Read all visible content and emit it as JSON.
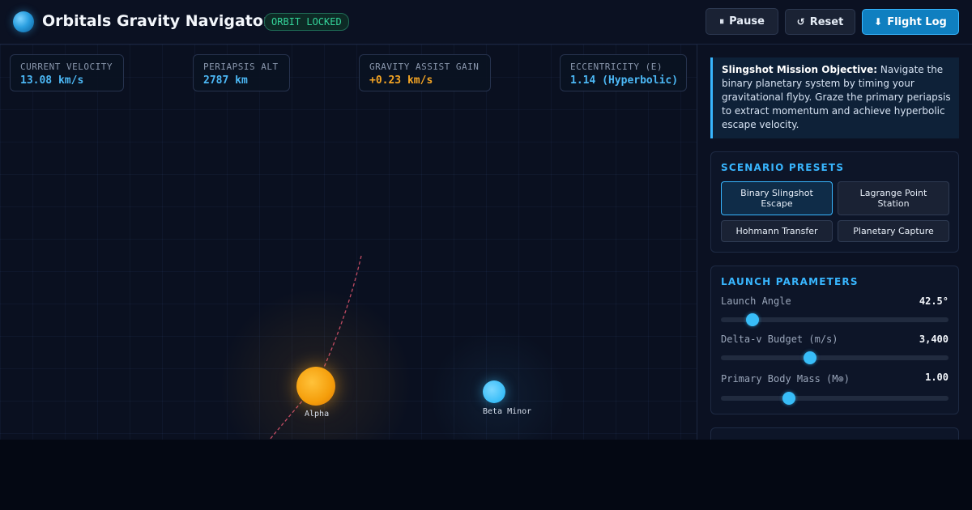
{
  "header": {
    "title": "Orbitals Gravity Navigator",
    "status_badge": "ORBIT LOCKED",
    "buttons": {
      "pause": {
        "icon": "⏸",
        "label": "Pause"
      },
      "reset": {
        "icon": "↺",
        "label": "Reset"
      },
      "flight_log": {
        "icon": "⬇",
        "label": "Flight Log"
      }
    }
  },
  "telemetry": {
    "velocity": {
      "label": "CURRENT VELOCITY",
      "value": "13.08 km/s",
      "color": "#4cb8f5"
    },
    "periapsis": {
      "label": "PERIAPSIS ALT",
      "value": "2787 km",
      "color": "#4cb8f5"
    },
    "gain": {
      "label": "GRAVITY ASSIST GAIN",
      "value": "+0.23 km/s",
      "color": "#f5a524"
    },
    "eccentricity": {
      "label": "ECCENTRICITY (E)",
      "value": "1.14 (Hyperbolic)",
      "color": "#4cb8f5"
    }
  },
  "bodies": {
    "primary": {
      "name": "Alpha",
      "color": "#f59e0b"
    },
    "secondary": {
      "name": "Beta Minor",
      "color": "#38bdf8"
    }
  },
  "objective": {
    "heading": "Slingshot Mission Objective:",
    "text": "Navigate the binary planetary system by timing your gravitational flyby. Graze the primary periapsis to extract momentum and achieve hyperbolic escape velocity."
  },
  "presets": {
    "title": "SCENARIO PRESETS",
    "items": [
      {
        "label": "Binary Slingshot Escape",
        "active": true
      },
      {
        "label": "Lagrange Point Station",
        "active": false
      },
      {
        "label": "Hohmann Transfer",
        "active": false
      },
      {
        "label": "Planetary Capture",
        "active": false
      }
    ]
  },
  "launch": {
    "title": "LAUNCH PARAMETERS",
    "params": [
      {
        "label": "Launch Angle",
        "value": "42.5°",
        "level": 0.14
      },
      {
        "label": "Delta-v Budget (m/s)",
        "value": "3,400",
        "level": 0.39
      },
      {
        "label": "Primary Body Mass (M⊕)",
        "value": "1.00",
        "level": 0.3
      }
    ]
  },
  "colors": {
    "accent": "#38b6ff",
    "background": "#0a1020",
    "trajectory": "#e0566e"
  }
}
